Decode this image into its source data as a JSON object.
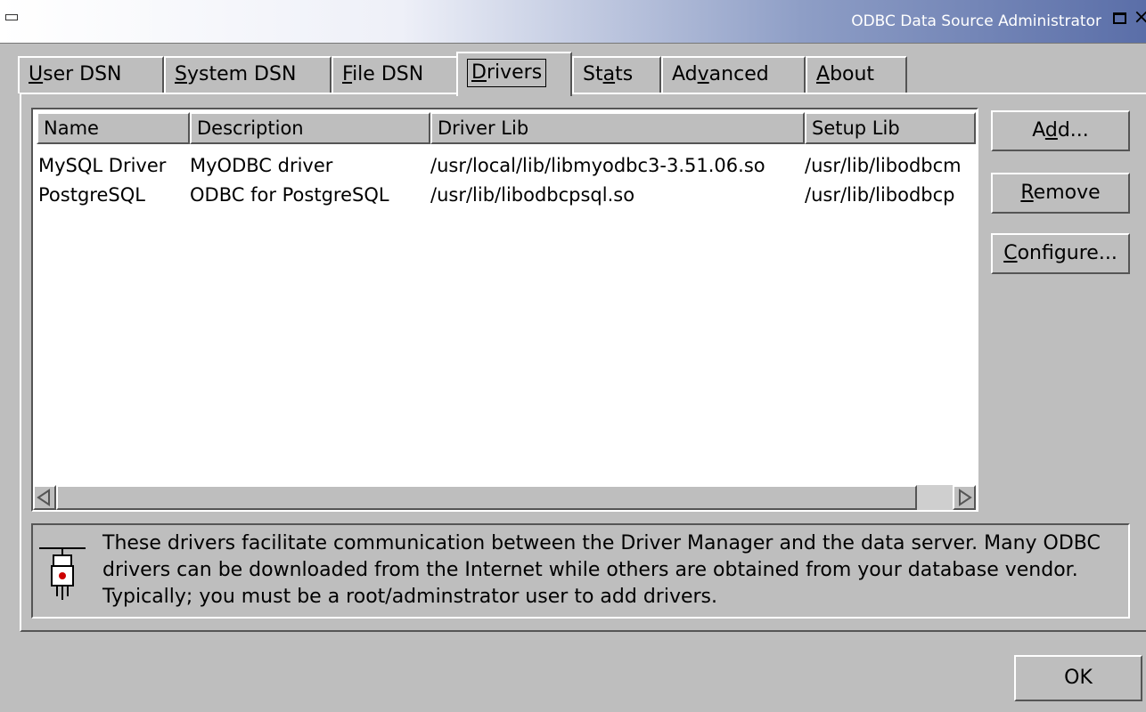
{
  "window": {
    "title": "ODBC Data Source Administrator"
  },
  "tabs": [
    {
      "label": "User DSN",
      "mnemonic": "U",
      "rest": "ser DSN",
      "active": false
    },
    {
      "label": "System DSN",
      "mnemonic": "S",
      "rest": "ystem DSN",
      "active": false
    },
    {
      "label": "File DSN",
      "mnemonic": "F",
      "rest": "ile DSN",
      "active": false
    },
    {
      "label": "Drivers",
      "mnemonic": "D",
      "rest": "rivers",
      "active": true
    },
    {
      "label": "Stats",
      "pre": "St",
      "mnemonic": "a",
      "rest": "ts",
      "active": false
    },
    {
      "label": "Advanced",
      "pre": "Ad",
      "mnemonic": "v",
      "rest": "anced",
      "active": false
    },
    {
      "label": "About",
      "mnemonic": "A",
      "rest": "bout",
      "active": false
    }
  ],
  "driver_table": {
    "columns": [
      "Name",
      "Description",
      "Driver Lib",
      "Setup Lib"
    ],
    "rows": [
      [
        "MySQL Driver",
        "MyODBC driver",
        "/usr/local/lib/libmyodbc3-3.51.06.so",
        "/usr/lib/libodbcm"
      ],
      [
        "PostgreSQL",
        "ODBC for PostgreSQL",
        "/usr/lib/libodbcpsql.so",
        "/usr/lib/libodbcp"
      ]
    ]
  },
  "buttons": {
    "add": {
      "pre": "A",
      "mnemonic": "d",
      "rest": "d..."
    },
    "remove": {
      "pre": "",
      "mnemonic": "R",
      "rest": "emove"
    },
    "configure": {
      "pre": "",
      "mnemonic": "C",
      "rest": "onfigure..."
    },
    "ok": {
      "label": "OK"
    }
  },
  "info": {
    "text": "These drivers facilitate communication between the Driver Manager and the data server. Many ODBC drivers can be downloaded from the Internet while others are obtained from your database vendor. Typically; you must be a root/adminstrator user to add drivers."
  },
  "colors": {
    "background": "#bebebe",
    "title_gradient_end": "#5a6ea8",
    "list_background": "#ffffff"
  },
  "icons": {
    "system_menu": "window-menu-icon",
    "maximize": "maximize-icon",
    "close": "close-icon",
    "info": "plug-icon"
  }
}
